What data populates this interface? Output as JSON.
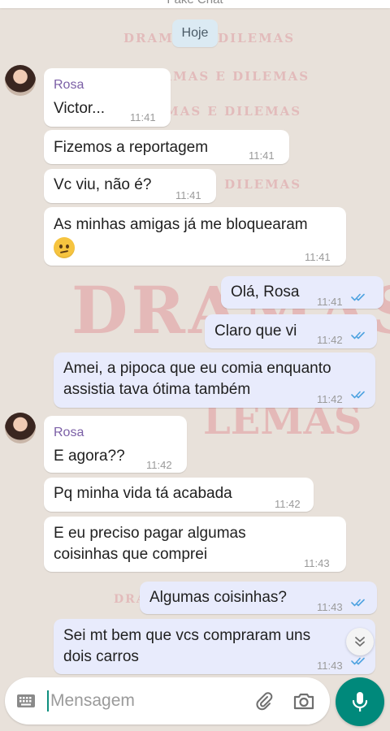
{
  "header": {
    "title": "Fake Chat"
  },
  "date_chip": "Hoje",
  "watermark": {
    "small": [
      "DRAMAS E DILEMAS",
      "DRAMAS E DILEMAS",
      "DRAMAS E DILEMAS",
      "DRAMAS E DILEMAS",
      "DRAMAS E DILEMAS",
      "DRAMAS E DILEMAS"
    ],
    "big": "DRAMAS",
    "big2": "LEMAS"
  },
  "messages": [
    {
      "sender": "Rosa",
      "text": "Victor...",
      "time": "11:41"
    },
    {
      "text": "Fizemos a reportagem",
      "time": "11:41"
    },
    {
      "text": "Vc viu, não é?",
      "time": "11:41"
    },
    {
      "text": "As minhas amigas já me bloquearam",
      "emoji": "worried-face-emoji",
      "time": "11:41"
    },
    {
      "text": "Olá, Rosa",
      "time": "11:41",
      "read": true
    },
    {
      "text": "Claro que vi",
      "time": "11:42",
      "read": true
    },
    {
      "lines": [
        "Amei, a pipoca que eu comia enquanto",
        "assistia tava ótima também"
      ],
      "time": "11:42",
      "read": true
    },
    {
      "sender": "Rosa",
      "text": "E agora??",
      "time": "11:42"
    },
    {
      "text": "Pq minha vida tá acabada",
      "time": "11:42"
    },
    {
      "lines": [
        "E eu preciso pagar algumas",
        "coisinhas que comprei"
      ],
      "time": "11:43"
    },
    {
      "text": "Algumas coisinhas?",
      "time": "11:43",
      "read": true
    },
    {
      "lines": [
        "Sei mt bem que vcs compraram uns",
        "dois carros"
      ],
      "time": "11:43",
      "read": true
    }
  ],
  "composer": {
    "placeholder": "Mensagem"
  },
  "colors": {
    "accent": "#00897b",
    "read_ticks": "#4fa3e0",
    "outgoing_bubble": "#e8ebfc",
    "incoming_bubble": "#ffffff",
    "sender_name": "#7b5fa6"
  }
}
